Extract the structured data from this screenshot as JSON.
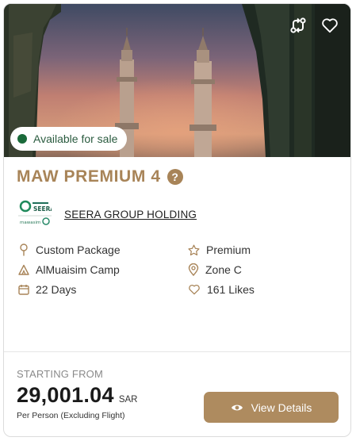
{
  "badge": {
    "label": "Available for sale",
    "color": "#1a6a3a"
  },
  "package": {
    "title": "MAW PREMIUM 4",
    "help_icon": "?"
  },
  "company": {
    "name": "SEERA GROUP HOLDING",
    "logo_arabic": "سيرا",
    "logo_text": "SEERA",
    "logo_sub_arabic": "مواسم",
    "logo_sub": "mawasim"
  },
  "features": {
    "left": [
      {
        "icon": "pin-icon",
        "label": "Custom Package"
      },
      {
        "icon": "tent-icon",
        "label": "AlMuaisim Camp"
      },
      {
        "icon": "calendar-icon",
        "label": "22 Days"
      }
    ],
    "right": [
      {
        "icon": "star-icon",
        "label": "Premium"
      },
      {
        "icon": "location-icon",
        "label": "Zone C"
      },
      {
        "icon": "heart-icon",
        "label": "161 Likes"
      }
    ]
  },
  "pricing": {
    "starting_label": "STARTING FROM",
    "price": "29,001.04",
    "currency": "SAR",
    "note": "Per Person (Excluding Flight)"
  },
  "actions": {
    "view_details": "View Details"
  },
  "colors": {
    "accent": "#a88458",
    "button": "#ae8b5f",
    "available": "#1a6a3a"
  }
}
